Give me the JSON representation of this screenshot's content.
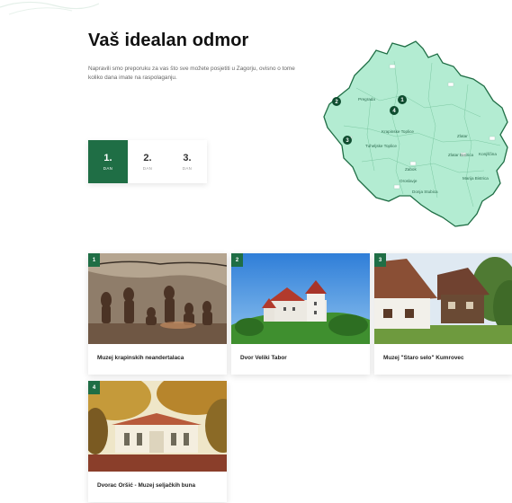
{
  "page": {
    "title": "Vaš idealan odmor",
    "intro": "Napravili smo preporuku za vas što sve možete posjetiti u Zagorju, ovisno o tome koliko dana imate na raspolaganju."
  },
  "colors": {
    "accent": "#1f6e45",
    "map_fill": "#b3ecd2",
    "map_outline": "#1f6e45"
  },
  "day_tabs": [
    {
      "number": "1.",
      "label": "DAN",
      "active": true
    },
    {
      "number": "2.",
      "label": "DAN",
      "active": false
    },
    {
      "number": "3.",
      "label": "DAN",
      "active": false
    }
  ],
  "map": {
    "towns": [
      "Pregrada",
      "Krapinske Toplice",
      "Tuheljske Toplice",
      "Zabok",
      "Oroslavje",
      "Donja Stubica",
      "Zlatar",
      "Zlatar Bistrica",
      "Konjščina",
      "Marija Bistrica"
    ],
    "markers": [
      "1",
      "2",
      "3",
      "4"
    ]
  },
  "attractions": [
    {
      "number": "1",
      "name": "Muzej krapinskih neandertalaca",
      "image": "neanderthal-diorama"
    },
    {
      "number": "2",
      "name": "Dvor Veliki Tabor",
      "image": "castle-on-hill"
    },
    {
      "number": "3",
      "name": "Muzej \"Staro selo\" Kumrovec",
      "image": "village-houses"
    },
    {
      "number": "4",
      "name": "Dvorac Oršić - Muzej seljačkih buna",
      "image": "manor-autumn"
    }
  ]
}
